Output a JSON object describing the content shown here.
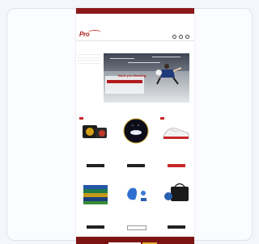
{
  "topbar": {
    "left_text": "",
    "right_text": ""
  },
  "promo": {
    "text": ""
  },
  "logo": {
    "text": "Pro"
  },
  "breadcrumb": {
    "text": ""
  },
  "sidebar": {
    "items": [
      "",
      "",
      "",
      ""
    ]
  },
  "hero": {
    "title": "Bowl you Bowling",
    "subtitle": ""
  },
  "section": {
    "title": "",
    "subtitle": ""
  },
  "products": [
    {
      "name": "",
      "price": "",
      "button": "",
      "sale": ""
    },
    {
      "name": "",
      "price": "",
      "button": "",
      "sale": ""
    },
    {
      "name": "",
      "price": "",
      "button": "",
      "sale": ""
    },
    {
      "name": "",
      "price": "",
      "button": "",
      "sale": ""
    },
    {
      "name": "",
      "price": "",
      "button": "",
      "sale": ""
    },
    {
      "name": "",
      "price": "",
      "button": "",
      "sale": ""
    }
  ],
  "footer": {
    "text": ""
  },
  "colors": {
    "brand": "#8b1a1a",
    "accent": "#c62828",
    "footer": "#7d1414"
  }
}
